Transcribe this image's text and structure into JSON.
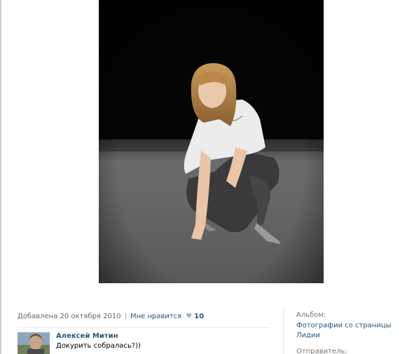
{
  "photo": {
    "alt": ""
  },
  "meta": {
    "added_text": "Добавлена 20 октября 2010",
    "separator": "|",
    "like_label": "Мне нравится",
    "like_icon": "heart-icon",
    "like_count": "10"
  },
  "comment": {
    "author": "Алексей Митин",
    "text": "Докурить собралась?))"
  },
  "sidebar": {
    "album_label": "Альбом:",
    "album_name_line1": "Фотографии со страницы",
    "album_name_line2": "Лидии",
    "sender_label": "Отправитель:"
  },
  "colors": {
    "link": "#2b587a",
    "muted": "#777777",
    "divider": "#e4e8ed"
  }
}
